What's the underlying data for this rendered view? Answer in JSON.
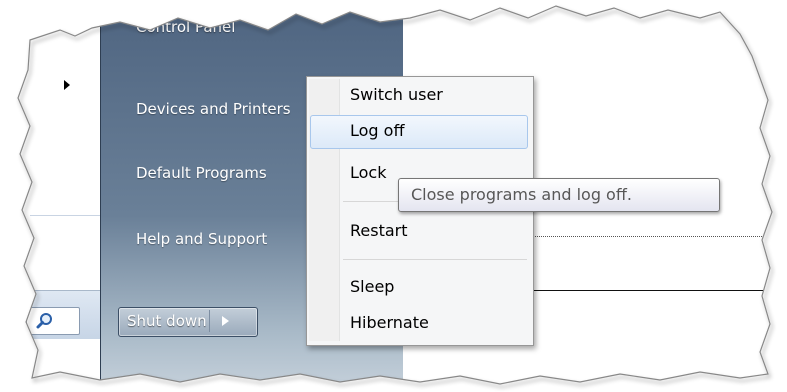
{
  "start_menu": {
    "right_items": [
      {
        "label": "Control Panel"
      },
      {
        "label": "Devices and Printers"
      },
      {
        "label": "Default Programs"
      },
      {
        "label": "Help and Support"
      }
    ],
    "shutdown_button": {
      "label": "Shut down"
    },
    "search_icon": "magnifier-icon",
    "submenu_arrow_icon": "right-arrow-icon"
  },
  "power_menu": {
    "items": [
      {
        "label": "Switch user"
      },
      {
        "label": "Log off",
        "highlighted": true
      },
      {
        "label": "Lock"
      },
      {
        "label": "Restart"
      },
      {
        "label": "Sleep"
      },
      {
        "label": "Hibernate"
      }
    ]
  },
  "tooltip": {
    "text": "Close programs and log off."
  },
  "colors": {
    "start_pane_top": "#4e6480",
    "menu_background": "#f5f6f7",
    "hover_border": "#a8c7ec"
  }
}
